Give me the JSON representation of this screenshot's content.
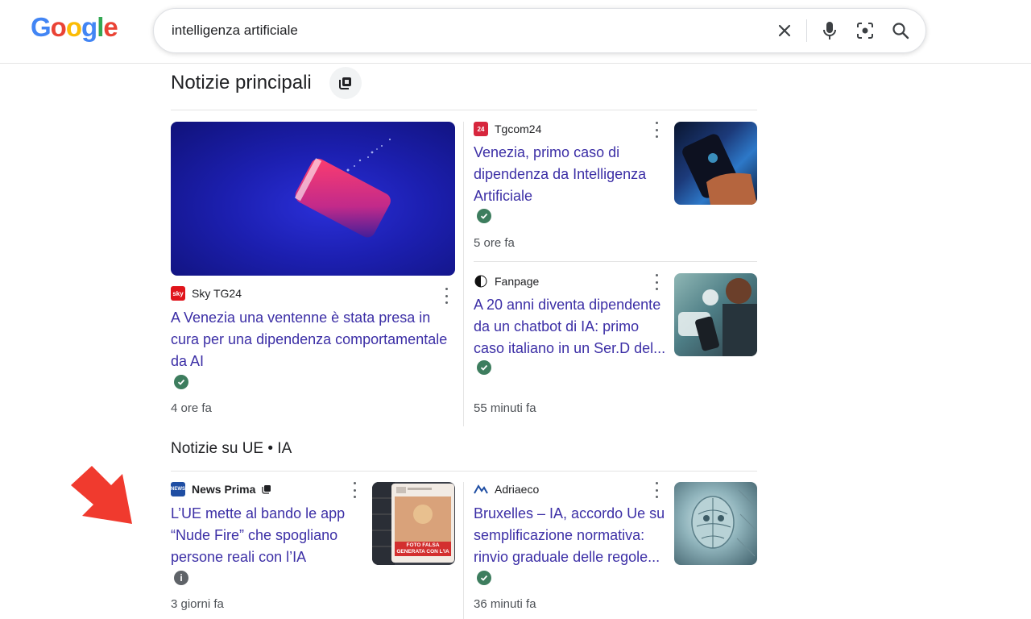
{
  "search": {
    "logo": [
      "G",
      "o",
      "o",
      "g",
      "l",
      "e"
    ],
    "logo_colors": [
      "#4285F4",
      "#EA4335",
      "#FBBC05",
      "#4285F4",
      "#34A853",
      "#EA4335"
    ],
    "query": "intelligenza artificiale"
  },
  "top_stories": {
    "title": "Notizie principali",
    "main": {
      "source": "Sky TG24",
      "headline": "A Venezia una ventenne è stata presa in cura per una dipendenza comportamentale da AI",
      "time": "4 ore fa"
    },
    "side": [
      {
        "source": "Tgcom24",
        "headline": "Venezia, primo caso di dipendenza da Intelligenza Artificiale",
        "time": "5 ore fa"
      },
      {
        "source": "Fanpage",
        "headline": "A 20 anni diventa dipendente da un chatbot di IA: primo caso italiano in un Ser.D del...",
        "time": "55 minuti fa"
      }
    ]
  },
  "eu_news": {
    "title": "Notizie su UE • IA",
    "items": [
      {
        "source": "News Prima",
        "headline": "L’UE mette al bando le app “Nude Fire” che spogliano persone reali con l’IA",
        "time": "3 giorni fa",
        "thumb_caption": "FOTO FALSA GENERATA CON L'IA"
      },
      {
        "source": "Adriaeco",
        "headline": "Bruxelles – IA, accordo Ue su semplificazione normativa: rinvio graduale delle regole...",
        "time": "36 minuti fa"
      }
    ]
  },
  "colors": {
    "link": "#3c2fa6",
    "verified": "#3d7d5e",
    "arrow": "#f03a2e"
  }
}
